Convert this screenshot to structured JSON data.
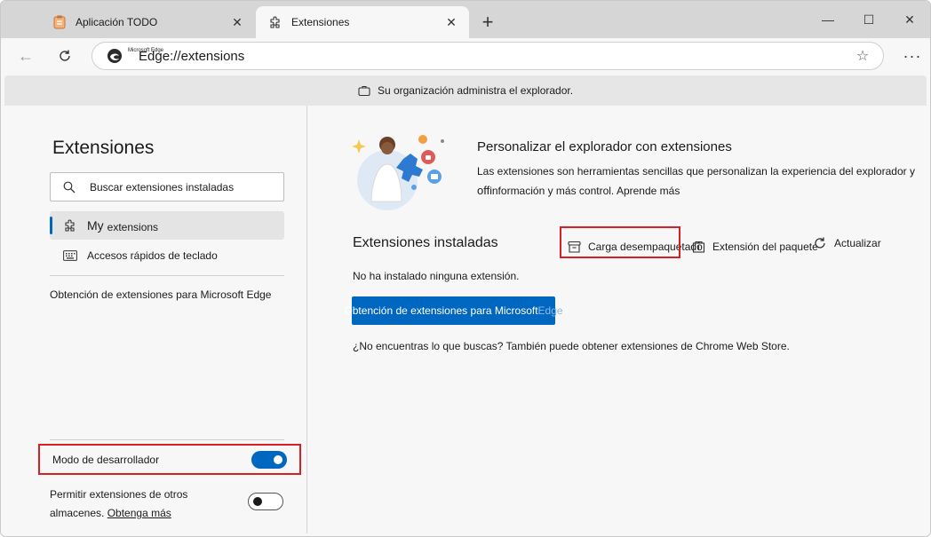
{
  "tabs": [
    {
      "title": "Aplicación TODO",
      "icon": "notepad-icon"
    },
    {
      "title": "Extensiones",
      "icon": "puzzle-icon"
    }
  ],
  "address_bar": {
    "site_label": "Microsoft Edge",
    "url": "Edge://extensions"
  },
  "managed_banner": "Su organización administra el explorador.",
  "sidebar": {
    "title": "Extensiones",
    "search_placeholder": "Buscar extensiones instaladas",
    "items": [
      {
        "label_main": "My",
        "label_sub": "extensions",
        "icon": "puzzle-icon"
      },
      {
        "label": "Accesos rápidos de teclado",
        "icon": "keyboard-icon"
      }
    ],
    "get_link": "Obtención de extensiones para Microsoft Edge",
    "developer_mode": {
      "label": "Modo de desarrollador",
      "enabled": true
    },
    "allow_other_stores": {
      "label": "Permitir extensiones de otros almacenes.",
      "learn_more": "Obtenga más",
      "enabled": false
    }
  },
  "main": {
    "hero": {
      "title": "Personalizar el explorador con extensiones",
      "desc_line1": "Las extensiones son herramientas sencillas que personalizan la experiencia del explorador y",
      "desc_off": "off",
      "desc_line2": "información y más control. Aprende más"
    },
    "installed_title": "Extensiones instaladas",
    "actions": {
      "load_unpacked": "Carga desempaquetado",
      "pack_extension": "Extensión del paquete",
      "update": "Actualizar"
    },
    "no_extensions": "No ha instalado ninguna extensión.",
    "get_button": {
      "label": "Obtención de extensiones para Microsoft",
      "label_faded": "Edge"
    },
    "chrome_note": "¿No encuentras lo que buscas? También puede obtener extensiones de Chrome Web Store."
  },
  "colors": {
    "accent": "#0067c0",
    "highlight_red": "#d61f26"
  }
}
